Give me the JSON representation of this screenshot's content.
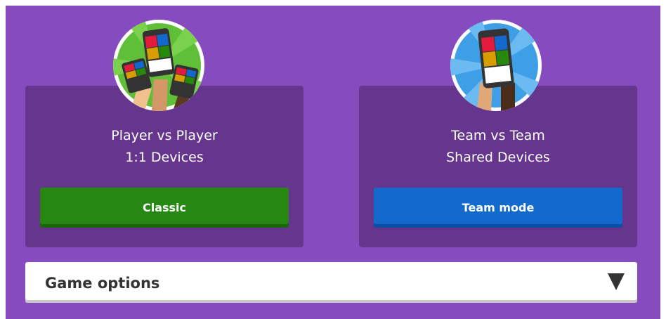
{
  "modes": [
    {
      "title_line1": "Player vs Player",
      "title_line2": "1:1 Devices",
      "button_label": "Classic",
      "button_color": "#268813",
      "illustration": "players-holding-phones-green"
    },
    {
      "title_line1": "Team vs Team",
      "title_line2": "Shared Devices",
      "button_label": "Team mode",
      "button_color": "#1469cd",
      "illustration": "team-holding-phone-blue"
    }
  ],
  "options": {
    "label": "Game options",
    "icon": "triangle-down-icon"
  },
  "colors": {
    "background": "#864cbf",
    "card": "#66368f"
  }
}
